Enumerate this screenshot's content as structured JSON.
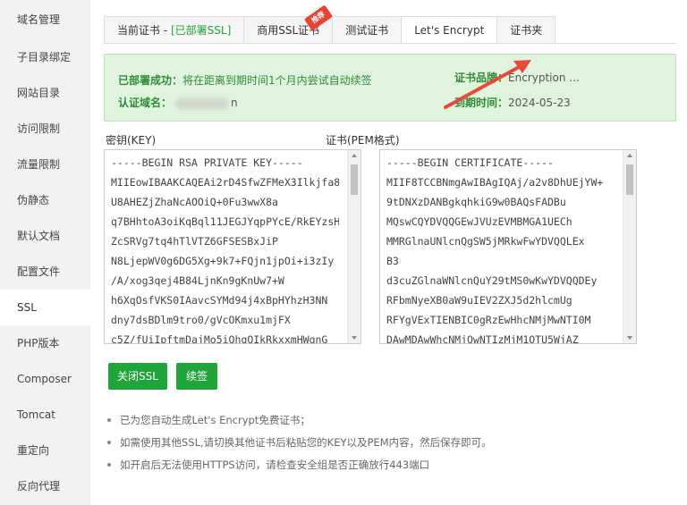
{
  "sidebar": {
    "items": [
      {
        "label": "域名管理"
      },
      {
        "label": "子目录绑定"
      },
      {
        "label": "网站目录"
      },
      {
        "label": "访问限制"
      },
      {
        "label": "流量限制"
      },
      {
        "label": "伪静态"
      },
      {
        "label": "默认文档"
      },
      {
        "label": "配置文件"
      },
      {
        "label": "SSL",
        "active": true
      },
      {
        "label": "PHP版本"
      },
      {
        "label": "Composer"
      },
      {
        "label": "Tomcat"
      },
      {
        "label": "重定向"
      },
      {
        "label": "反向代理"
      }
    ]
  },
  "tabs": {
    "current_prefix": "当前证书 - ",
    "current_status": "[已部署SSL]",
    "commercial": "商用SSL证书",
    "new_badge": "推荐",
    "test": "测试证书",
    "letsencrypt": "Let's Encrypt",
    "folder": "证书夹"
  },
  "status": {
    "deployed_label": "已部署成功：",
    "deployed_text": "将在距离到期时间1个月内尝试自动续签",
    "domain_label": "认证域名：",
    "domain_suffix": "n",
    "brand_label": "证书品牌：",
    "brand_value": "Encryption ...",
    "expire_label": "到期时间：",
    "expire_value": "2024-05-23"
  },
  "key": {
    "label": "密钥(KEY)",
    "lines": [
      "-----BEGIN RSA PRIVATE KEY-----",
      "MIIEowIBAAKCAQEAi2rD4SfwZFMeX3Ilkjfa8",
      "U8AHEZjZhaNcAOOiQ+0Fu3wwX8a",
      "q7BHhtoA3oiKqBql11JEGJYqpPYcE/RkEYzsH",
      "ZcSRVg7tq4hTlVTZ6GFSESBxJiP",
      "N8LjepWV0g6DG5Xg+9k7+FQjn1jpOi+i3zIy",
      "/A/xog3qej4B84LjnKn9gKnUw7+W",
      "h6XqOsfVKS0IAavcSYMd94j4xBpHYhzH3NN",
      "dny7dsBDlm9tro0/gVcOKmxu1mjFX",
      "c5Z/fUiIpftmDajMo5iQhqQIkRkxxmHWqnG"
    ]
  },
  "cert": {
    "label": "证书(PEM格式)",
    "lines": [
      "-----BEGIN CERTIFICATE-----",
      "MIIF8TCCBNmgAwIBAgIQAj/a2v8DhUEjYW+",
      "9tDNXzDANBgkqhkiG9w0BAQsFADBu",
      "MQswCQYDVQQGEwJVUzEVMBMGA1UECh",
      "MMRGlnaUNlcnQgSW5jMRkwFwYDVQQLEx",
      "B3",
      "d3cuZGlnaWNlcnQuY29tMS0wKwYDVQQDEy",
      "RFbmNyeXB0aW9uIEV2ZXJ5d2hlcmUg",
      "RFYgVExTIENBIC0gRzEwHhcNMjMwNTI0M",
      "DAwMDAwWhcNMjQwNTIzMjM1OTU5WjAZ"
    ]
  },
  "buttons": {
    "close_ssl": "关闭SSL",
    "renew": "续签"
  },
  "notes": [
    "已为您自动生成Let's Encrypt免费证书；",
    "如需使用其他SSL,请切换其他证书后粘贴您的KEY以及PEM内容，然后保存即可。",
    "如开启后无法使用HTTPS访问，请检查安全组是否正确放行443端口"
  ]
}
